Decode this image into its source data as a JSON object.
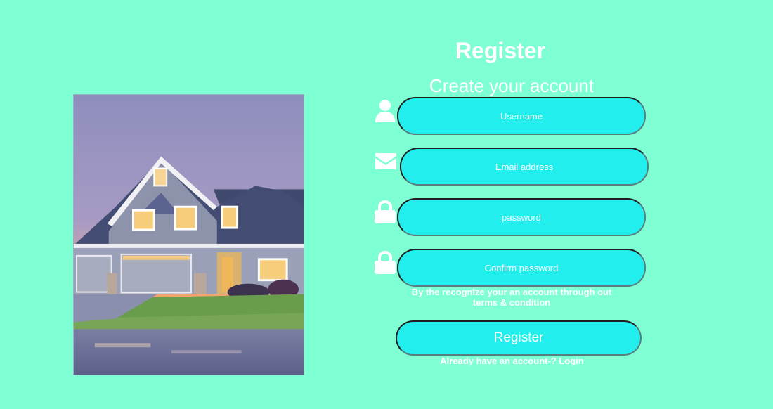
{
  "colors": {
    "background": "#7fffd4",
    "input_fill": "#22eeee",
    "text": "#ffffff"
  },
  "illustration": {
    "subject": "house-photo"
  },
  "form": {
    "title": "Register",
    "subtitle": "Create your account",
    "fields": {
      "username": {
        "placeholder": "Username",
        "icon": "user-icon"
      },
      "email": {
        "placeholder": "Email address",
        "icon": "envelope-icon"
      },
      "password": {
        "placeholder": "password",
        "icon": "lock-icon"
      },
      "confirm_password": {
        "placeholder": "Confirm password",
        "icon": "lock-icon"
      }
    },
    "terms_line1": "By the recognize your an account through out",
    "terms_line2": "terms & condition",
    "submit_label": "Register",
    "login_prompt": "Already have an account-?",
    "login_link": "Login"
  }
}
